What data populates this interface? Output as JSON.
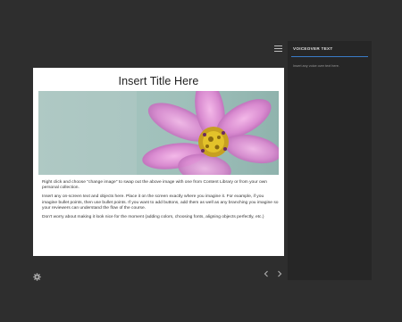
{
  "slide": {
    "title": "Insert Title Here",
    "paragraphs": [
      "Right click and choose \"change image\" to swap out the above image with one from Content Library or from your own personal collection.",
      "Insert any on-screen text and objects here. Place it on the screen exactly where you imagine it. For example, if you imagine bullet points, then use bullet points. If you want to add buttons, add them as well as any branching you imagine so your reviewers can understand the flow of the course.",
      "Don't worry about making it look nice for the moment (adding colors, choosing fonts, aligning objects perfectly, etc.)"
    ]
  },
  "voiceover": {
    "title": "VOICEOVER TEXT",
    "text": "Insert any voice over text here."
  },
  "icons": {
    "menu": "hamburger-menu-icon",
    "settings": "gear-icon",
    "prev": "chevron-left-icon",
    "next": "chevron-right-icon"
  },
  "colors": {
    "background": "#2e2e2e",
    "panel": "#262626",
    "accent": "#3a7cc8",
    "slide": "#ffffff"
  }
}
